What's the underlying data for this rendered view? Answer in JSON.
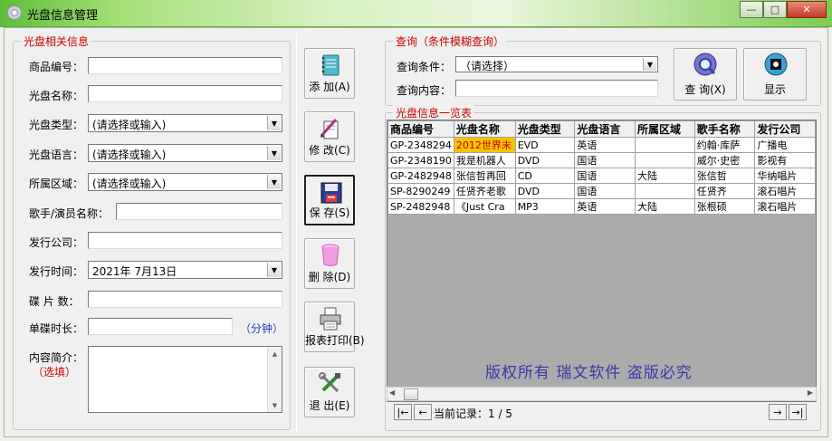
{
  "window": {
    "title": "光盘信息管理",
    "minimize": "—",
    "maximize": "□",
    "close": "✕"
  },
  "left_group": {
    "title": "光盘相关信息",
    "fields": {
      "product_id": {
        "label": "商品编号：",
        "value": ""
      },
      "disc_name": {
        "label": "光盘名称：",
        "value": ""
      },
      "disc_type": {
        "label": "光盘类型：",
        "value": "(请选择或输入)"
      },
      "disc_language": {
        "label": "光盘语言：",
        "value": "(请选择或输入)"
      },
      "region": {
        "label": "所属区域：",
        "value": "(请选择或输入)"
      },
      "singer": {
        "label": "歌手/演员名称：",
        "value": ""
      },
      "publisher": {
        "label": "发行公司：",
        "value": ""
      },
      "release_date": {
        "label": "发行时间：",
        "value": "2021年 7月13日"
      },
      "disc_count": {
        "label": "碟 片 数：",
        "value": ""
      },
      "duration": {
        "label": "单碟时长：",
        "value": "",
        "unit": "（分钟）"
      },
      "summary": {
        "label": "内容简介：",
        "note": "（选填）",
        "value": ""
      }
    }
  },
  "buttons": {
    "add": "添 加(A)",
    "edit": "修 改(C)",
    "save": "保 存(S)",
    "delete": "删 除(D)",
    "print": "报表打印(B)",
    "exit": "退 出(E)"
  },
  "query_group": {
    "title": "查询（条件模糊查询）",
    "condition_label": "查询条件：",
    "condition_value": "（请选择）",
    "content_label": "查询内容：",
    "content_value": "",
    "query_button": "查 询(X)",
    "show_button": "显示"
  },
  "list_group": {
    "title": "光盘信息一览表",
    "columns": [
      "商品编号",
      "光盘名称",
      "光盘类型",
      "光盘语言",
      "所属区域",
      "歌手名称",
      "发行公司"
    ],
    "rows": [
      [
        "GP-2348294",
        "2012世界末",
        "EVD",
        "英语",
        "",
        "约翰·库萨",
        "广播电"
      ],
      [
        "GP-2348190",
        "我是机器人",
        "DVD",
        "国语",
        "",
        "威尔·史密",
        "影视有"
      ],
      [
        "GP-2482948",
        "张信哲再回",
        "CD",
        "国语",
        "大陆",
        "张信哲",
        "华纳唱片"
      ],
      [
        "SP-8290249",
        "任贤齐老歌",
        "DVD",
        "国语",
        "",
        "任贤齐",
        "滚石唱片"
      ],
      [
        "SP-2482948",
        "《Just Cra",
        "MP3",
        "英语",
        "大陆",
        "张根硕",
        "滚石唱片"
      ]
    ],
    "watermark": "版权所有  瑞文软件  盗版必究",
    "current_record": "当前记录：1 / 5"
  },
  "colors": {
    "accent_red": "#cc0000",
    "unit_blue": "#1e3fb0",
    "watermark": "#3a38a8",
    "selected_cell": "#f5c400"
  }
}
